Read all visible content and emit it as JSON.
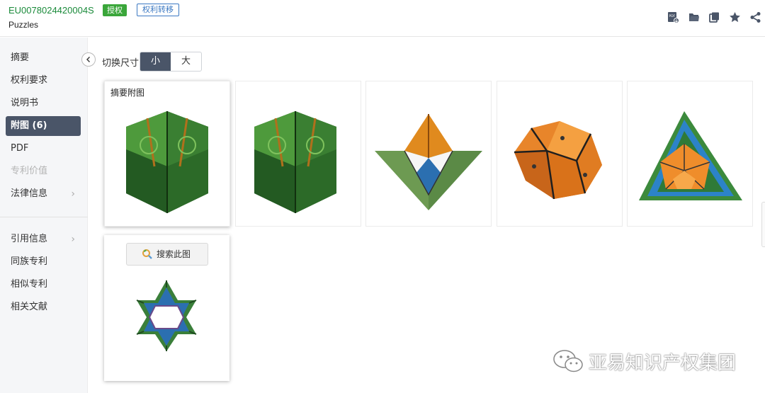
{
  "header": {
    "pub_number": "EU0078024420004S",
    "status_badge": "授权",
    "transfer_badge": "权利转移",
    "title": "Puzzles",
    "tools": [
      "pdf-download-icon",
      "folder-icon",
      "copy-icon",
      "star-icon",
      "share-icon"
    ]
  },
  "sidebar": {
    "items": [
      {
        "label": "摘要"
      },
      {
        "label": "权利要求"
      },
      {
        "label": "说明书"
      },
      {
        "label": "附图 (6)"
      },
      {
        "label": "PDF"
      },
      {
        "label": "专利价值"
      },
      {
        "label": "法律信息"
      },
      {
        "label": "引用信息"
      },
      {
        "label": "同族专利"
      },
      {
        "label": "相似专利"
      },
      {
        "label": "相关文献"
      }
    ]
  },
  "size_switch": {
    "label": "切换尺寸",
    "small": "小",
    "large": "大",
    "selected": "小"
  },
  "figures": {
    "abstract_label": "摘要附图",
    "search_button": "搜索此图",
    "count": 6
  },
  "watermark": "亚易知识产权集团",
  "colors": {
    "accent": "#4a5568",
    "green_text": "#1a8a3a",
    "grant_green": "#3aa63a",
    "transfer_blue": "#3b78c2"
  }
}
